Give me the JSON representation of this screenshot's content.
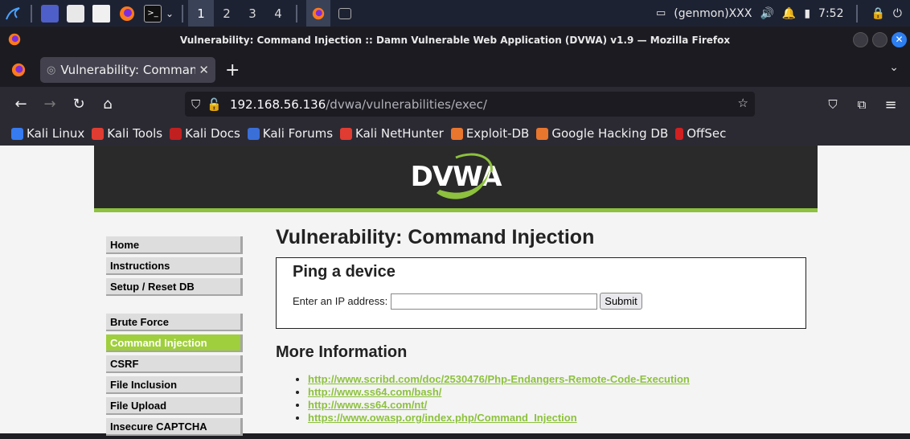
{
  "taskbar": {
    "workspaces": [
      "1",
      "2",
      "3",
      "4"
    ],
    "genmon": "(genmon)XXX",
    "clock": "7:52"
  },
  "window": {
    "title": "Vulnerability: Command Injection :: Damn Vulnerable Web Application (DVWA) v1.9 — Mozilla Firefox"
  },
  "tab": {
    "label": "Vulnerability: Command In"
  },
  "urlbar": {
    "host": "192.168.56.136",
    "path": "/dvwa/vulnerabilities/exec/"
  },
  "bookmarks": [
    {
      "label": "Kali Linux",
      "color": "#367bf0"
    },
    {
      "label": "Kali Tools",
      "color": "#e03c31"
    },
    {
      "label": "Kali Docs",
      "color": "#c02020"
    },
    {
      "label": "Kali Forums",
      "color": "#3a6fd8"
    },
    {
      "label": "Kali NetHunter",
      "color": "#e03c31"
    },
    {
      "label": "Exploit-DB",
      "color": "#e8762d"
    },
    {
      "label": "Google Hacking DB",
      "color": "#e8762d"
    },
    {
      "label": "OffSec",
      "color": "#d02020"
    }
  ],
  "dvwa": {
    "logo": "DVWA",
    "menu": {
      "home": "Home",
      "instructions": "Instructions",
      "setup": "Setup / Reset DB",
      "brute_force": "Brute Force",
      "command_injection": "Command Injection",
      "csrf": "CSRF",
      "file_inclusion": "File Inclusion",
      "file_upload": "File Upload",
      "insecure_captcha": "Insecure CAPTCHA"
    },
    "heading": "Vulnerability: Command Injection",
    "box_title": "Ping a device",
    "ip_label": "Enter an IP address:",
    "ip_value": "",
    "submit_label": "Submit",
    "more_info_title": "More Information",
    "links": [
      "http://www.scribd.com/doc/2530476/Php-Endangers-Remote-Code-Execution",
      "http://www.ss64.com/bash/",
      "http://www.ss64.com/nt/",
      "https://www.owasp.org/index.php/Command_Injection"
    ]
  },
  "colors": {
    "accent_green": "#8dc13e",
    "active_menu": "#9fcf3c",
    "header_dark": "#2a2a2a"
  }
}
